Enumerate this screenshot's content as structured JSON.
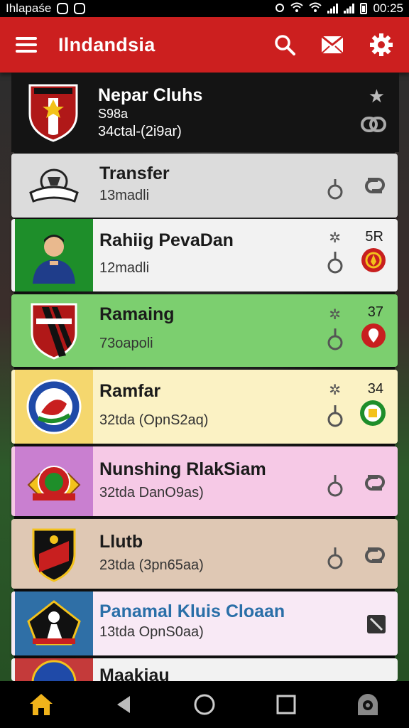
{
  "status_bar": {
    "carrier": "Ihlapaśe",
    "time": "00:25"
  },
  "app_bar": {
    "title": "Ilndandsia"
  },
  "header": {
    "name": "Nepar Cluhs",
    "subtitle": "S98a",
    "stat": "34ctal-(2i9ar)"
  },
  "rows": [
    {
      "title": "Transfer",
      "subtitle": "13madli",
      "rank": "",
      "bg": "#dcdcdc",
      "thumb_bg": "#dcdcdc"
    },
    {
      "title": "Rahiig PevaDan",
      "subtitle": "12madli",
      "rank": "5R",
      "bg": "#f2f2f2",
      "thumb_bg": "#1e8e2a"
    },
    {
      "title": "Ramaing",
      "subtitle": "73oapoli",
      "rank": "37",
      "bg": "#7ccf6f",
      "thumb_bg": "#7ccf6f"
    },
    {
      "title": "Ramfar",
      "subtitle": "32tda (OpnS2aq)",
      "rank": "34",
      "bg": "#fbf2c4",
      "thumb_bg": "#f5d76e"
    },
    {
      "title": "Nunshing RlakSiam",
      "subtitle": "32tda DanO9as)",
      "rank": "",
      "bg": "#f6c9e6",
      "thumb_bg": "#c97fd0"
    },
    {
      "title": "Llutb",
      "subtitle": "23tda (3pn65aa)",
      "rank": "",
      "bg": "#dfc8b4",
      "thumb_bg": "#dfc8b4"
    },
    {
      "title": "Panamal Kluis Cloaan",
      "subtitle": "13tda OpnS0aa)",
      "rank": "",
      "bg": "#f8e9f5",
      "thumb_bg": "#2f6fa6"
    },
    {
      "title": "Maakiau",
      "subtitle": "",
      "rank": "",
      "bg": "#f2f2f2",
      "thumb_bg": "#c43a3a"
    }
  ],
  "colors": {
    "accent": "#cc1f1f",
    "nav_home": "#f0b31b"
  },
  "icons": [
    "menu-icon",
    "search-icon",
    "mail-icon",
    "settings-icon",
    "star-icon",
    "link-icon",
    "pin-icon",
    "home-icon",
    "back-icon",
    "circle-home-icon",
    "recents-icon",
    "assistant-icon"
  ]
}
